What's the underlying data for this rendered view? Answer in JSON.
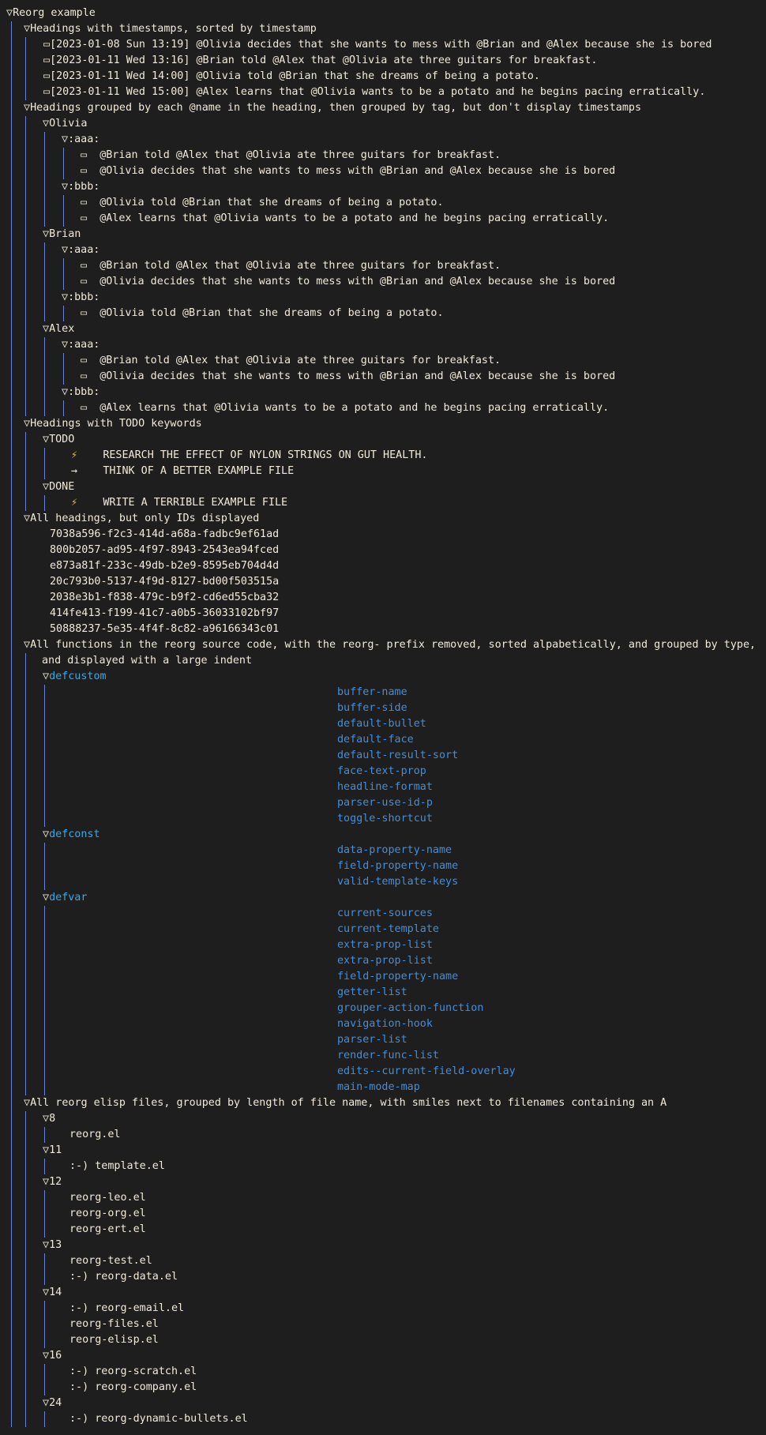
{
  "outline": {
    "root": {
      "marker": "▽",
      "title": "Reorg example"
    },
    "timestamps": {
      "marker": "▽",
      "title": "Headings with timestamps, sorted by timestamp",
      "bullet": "▭",
      "items": [
        "[2023-01-08 Sun 13:19] @Olivia decides that she wants to mess with @Brian and @Alex because she is bored",
        "[2023-01-11 Wed 13:16] @Brian told @Alex that @Olivia ate three guitars for breakfast.",
        "[2023-01-11 Wed 14:00] @Olivia told @Brian that she dreams of being a potato.",
        "[2023-01-11 Wed 15:00] @Alex learns that @Olivia wants to be a potato and he begins pacing erratically."
      ]
    },
    "grouped": {
      "marker": "▽",
      "title": "Headings grouped by each @name in the heading, then grouped by tag, but don't display timestamps",
      "bullet": "▭",
      "groups": [
        {
          "name": "Olivia",
          "tags": [
            {
              "tag": ":aaa:",
              "items": [
                "@Brian told @Alex that @Olivia ate three guitars for breakfast.",
                "@Olivia decides that she wants to mess with @Brian and @Alex because she is bored"
              ]
            },
            {
              "tag": ":bbb:",
              "items": [
                "@Olivia told @Brian that she dreams of being a potato.",
                "@Alex learns that @Olivia wants to be a potato and he begins pacing erratically."
              ]
            }
          ]
        },
        {
          "name": "Brian",
          "tags": [
            {
              "tag": ":aaa:",
              "items": [
                "@Brian told @Alex that @Olivia ate three guitars for breakfast.",
                "@Olivia decides that she wants to mess with @Brian and @Alex because she is bored"
              ]
            },
            {
              "tag": ":bbb:",
              "items": [
                "@Olivia told @Brian that she dreams of being a potato."
              ]
            }
          ]
        },
        {
          "name": "Alex",
          "tags": [
            {
              "tag": ":aaa:",
              "items": [
                "@Brian told @Alex that @Olivia ate three guitars for breakfast.",
                "@Olivia decides that she wants to mess with @Brian and @Alex because she is bored"
              ]
            },
            {
              "tag": ":bbb:",
              "items": [
                "@Alex learns that @Olivia wants to be a potato and he begins pacing erratically."
              ]
            }
          ]
        }
      ]
    },
    "todo": {
      "marker": "▽",
      "title": "Headings with TODO keywords",
      "groups": [
        {
          "name": "TODO",
          "items": [
            {
              "icon": "⚡",
              "icon_name": "lightning-icon",
              "text": "RESEARCH THE EFFECT OF NYLON STRINGS ON GUT HEALTH."
            },
            {
              "icon": "→",
              "icon_name": "arrow-icon",
              "text": "THINK OF A BETTER EXAMPLE FILE"
            }
          ]
        },
        {
          "name": "DONE",
          "items": [
            {
              "icon": "⚡",
              "icon_name": "lightning-icon",
              "text": "WRITE A TERRIBLE EXAMPLE FILE"
            }
          ]
        }
      ]
    },
    "ids": {
      "marker": "▽",
      "title": "All headings, but only IDs displayed",
      "items": [
        "7038a596-f2c3-414d-a68a-fadbc9ef61ad",
        "800b2057-ad95-4f97-8943-2543ea94fced",
        "e873a81f-233c-49db-b2e9-8595eb704d4d",
        "20c793b0-5137-4f9d-8127-bd00f503515a",
        "2038e3b1-f838-479c-b9f2-cd6ed55cba32",
        "414fe413-f199-41c7-a0b5-36033102bf97",
        "50888237-5e35-4f4f-8c82-a96166343c01"
      ]
    },
    "functions": {
      "marker": "▽",
      "title_line1": "All functions in the reorg source code, with the reorg- prefix removed, sorted alpabetically, and grouped by type,",
      "title_line2": "and displayed with a large indent",
      "groups": [
        {
          "name": "defcustom",
          "items": [
            "buffer-name",
            "buffer-side",
            "default-bullet",
            "default-face",
            "default-result-sort",
            "face-text-prop",
            "headline-format",
            "parser-use-id-p",
            "toggle-shortcut"
          ]
        },
        {
          "name": "defconst",
          "items": [
            "data-property-name",
            "field-property-name",
            "valid-template-keys"
          ]
        },
        {
          "name": "defvar",
          "items": [
            "current-sources",
            "current-template",
            "extra-prop-list",
            "extra-prop-list",
            "field-property-name",
            "getter-list",
            "grouper-action-function",
            "navigation-hook",
            "parser-list",
            "render-func-list",
            "edits--current-field-overlay",
            "main-mode-map"
          ]
        }
      ]
    },
    "files": {
      "marker": "▽",
      "title": "All reorg elisp files, grouped by length of file name, with smiles next to filenames containing an A",
      "groups": [
        {
          "name": "8",
          "items": [
            "reorg.el"
          ]
        },
        {
          "name": "11",
          "items": [
            ":-) template.el"
          ]
        },
        {
          "name": "12",
          "items": [
            "reorg-leo.el",
            "reorg-org.el",
            "reorg-ert.el"
          ]
        },
        {
          "name": "13",
          "items": [
            "reorg-test.el",
            ":-) reorg-data.el"
          ]
        },
        {
          "name": "14",
          "items": [
            ":-) reorg-email.el",
            "reorg-files.el",
            "reorg-elisp.el"
          ]
        },
        {
          "name": "16",
          "items": [
            ":-) reorg-scratch.el",
            ":-) reorg-company.el"
          ]
        },
        {
          "name": "24",
          "items": [
            ":-) reorg-dynamic-bullets.el"
          ]
        }
      ]
    }
  },
  "colors": {
    "background": "#1e1e1e",
    "text": "#f2ead8",
    "guide_line": "#6e80d6",
    "function_name": "#3f8fe0",
    "def_heading": "#38a9e4",
    "lightning": "#f1c40f"
  }
}
